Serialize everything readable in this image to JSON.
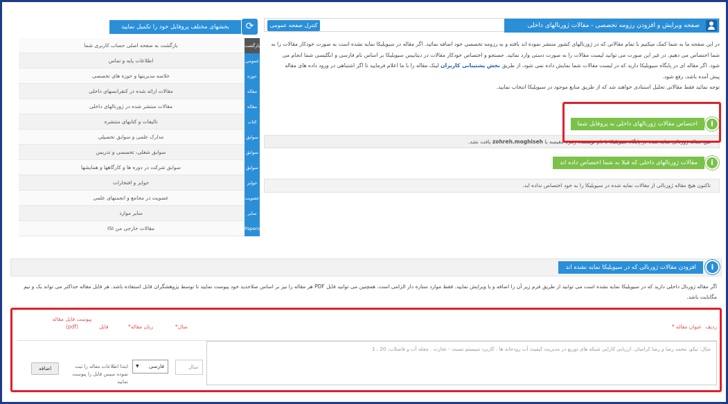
{
  "main_header": {
    "title": "صفحه ویرایش و افزودن رزومه تخصصی - مقالات ژورنالهای داخلی",
    "control_button": "کنترل صفحه عمومی"
  },
  "intro": {
    "lines": [
      "در این صفحه ما به شما کمک میکنیم با تمام مقالاتی که در ژورنالهای کشور منتشر نموده اند یافته و به رزومه تخصصی خود اضافه نمائید. اگر مقاله در سیویلیکا نمایه نشده است به صورت خودکار مقالات را به",
      "شما اختصاص می دهیم. در غیر این صورت می توانید لیست مقالات را به صورت دستی وارد نمائید. جستجو و اختصاص خودکار مقالات در دیتابیس سیویلیکا بر اساس نام فارسی و انگلیسی شما انجام می",
      "شود. اگر مقاله ای در پایگاه سیویلیکا دارید که در لیست مقالات شما نمایش داده نمی شود، از طریق",
      "پیش آمده باشد، رفع شود.",
      "توجه نمائید فقط مقالاتی تحلیل استنادی خواهند شد که از طریق منابع موجود در سیویلیکا انتخاب نمایید."
    ],
    "link_text": "بخش پشتیبانی کاربران",
    "line3_tail": "لینک مقاله را با ما اعلام فرمایید تا اگر اشتباهی در ورود داده های مقاله"
  },
  "section_assigned": {
    "label": "اختصاص مقالات ژورنالهای داخلی به پروفایل شما",
    "message_prefix": "هیچ مقاله ژورنالی نمایه شده در پایگاه سیویلیکا با نام نویسنده زهره مقیسه یا",
    "message_email": "zohreh.moghiseh",
    "message_suffix": "یافت نشد."
  },
  "section_previously": {
    "label": "مقالات ژورنالهای داخلی که قبلا به شما اختصاص داده اند",
    "message": "تاکنون هیچ مقاله ژورنالی از مقالات نمایه شده در سیویلیکا را به خود اختصاص نداده اید."
  },
  "sidebar": {
    "title": "بخشهای مختلف پروفایل خود را تکمیل نمایید",
    "icon": "refresh-icon",
    "items": [
      {
        "tag": "بازگشت",
        "label": "بازگشت به صفحه اصلی حساب کاربری شما",
        "active": true
      },
      {
        "tag": "عمومی",
        "label": "اطلاعات پایه و تماس"
      },
      {
        "tag": "حوزه",
        "label": "خلاصه مدیریتها و حوزه های تخصصی"
      },
      {
        "tag": "مقاله",
        "label": "مقالات ارائه شده در کنفرانسهای داخلی"
      },
      {
        "tag": "مقاله",
        "label": "مقالات منتشر شده در ژورنالهای داخلی"
      },
      {
        "tag": "کتاب",
        "label": "تالیفات و کتابهای منتشره"
      },
      {
        "tag": "سوابق",
        "label": "مدارک علمی و سوابق تحصیلی"
      },
      {
        "tag": "سوابق",
        "label": "سوابق شغلی، تخصصی و تدریس"
      },
      {
        "tag": "سوابق",
        "label": "سوابق شرکت در دوره ها و کارگاهها و همایشها"
      },
      {
        "tag": "جوایز",
        "label": "جوایز و افتخارات"
      },
      {
        "tag": "عضویت",
        "label": "عضویت در مجامع و انجمنهای علمی"
      },
      {
        "tag": "سایر",
        "label": "سایر موارد"
      },
      {
        "tag": "Papers",
        "label": "مقالات خارجی من ISI"
      }
    ]
  },
  "add_section": {
    "label": "افزودن مقالات ژورنالی که در سیویلیکا نمایه نشده اند",
    "description": "اگر مقاله ژورنال داخلی دارید که در سیویلیکا نمایه نشده است می توانید از طریق فرم زیر آن را اضافه و یا ویرایش نمایید. فقط موارد ستاره دار الزامی است. همچنین می توانید فایل PDF هر مقاله را نیز بر اساس صلاحدید خود پیوست نمایید تا توسط پژوهشگران قابل استفاده باشد. هر فایل مقاله حداکثر می تواند یک و نیم مگابایت باشد."
  },
  "form": {
    "col_row": "ردیف",
    "col_title": "عنوان مقاله",
    "col_year": "سال",
    "col_lang": "زبان مقاله",
    "col_file": "فایل",
    "col_attach": "پیوست فایل مقاله (pdf)",
    "title_placeholder": "مثال: تیکو، محمد رضا و رضا کرامیان. ارزیابی کارایی شبکه های توزیع در مدیریت کیفیت آب رودخانه ها . کاربرد سیستم نسبت - تجارت . مجله آب و فاضلاب، 20 ، 1",
    "year_placeholder": "سال",
    "lang_value": "فارسی",
    "upload_note": "ابتدا اطلاعات مقاله را ثبت نموده سپس فایل را پیوست نمایید",
    "add_button": "اضافه"
  },
  "colors": {
    "accent_blue": "#2b8fd8",
    "accent_green": "#7bc24a",
    "highlight_red": "#e0202a",
    "frame_navy": "#1e3a8a"
  }
}
